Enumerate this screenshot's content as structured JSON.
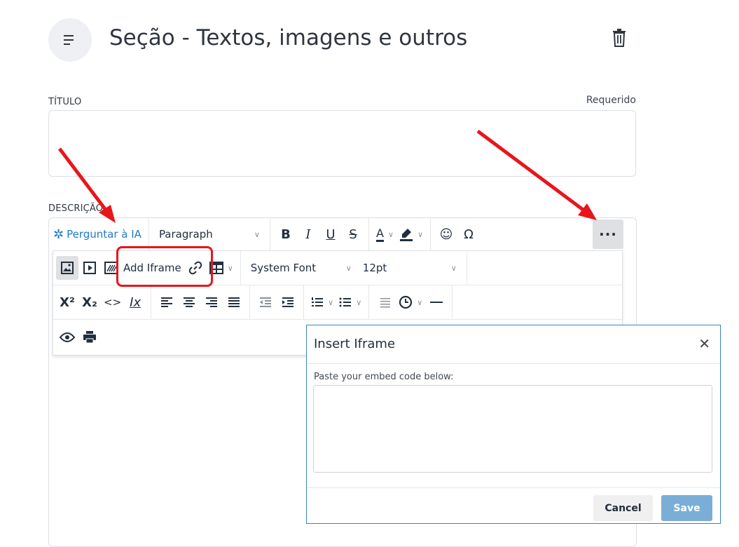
{
  "header": {
    "title": "Seção - Textos, imagens e outros"
  },
  "fields": {
    "title_label": "TÍTULO",
    "required_label": "Requerido",
    "description_label": "DESCRIÇÃO"
  },
  "toolbar": {
    "ai_button": "Perguntar à IA",
    "block_format": "Paragraph",
    "bold": "B",
    "italic": "I",
    "underline": "U",
    "strike": "S",
    "text_color": "A",
    "omega": "Ω",
    "more": "···",
    "add_iframe": "Add Iframe",
    "font_family": "System Font",
    "font_size": "12pt",
    "superscript": "X²",
    "subscript": "X₂",
    "code": "<>",
    "clear_format": "Ix"
  },
  "dialog": {
    "title": "Insert Iframe",
    "prompt": "Paste your embed code below:",
    "cancel": "Cancel",
    "save": "Save"
  },
  "colors": {
    "accent": "#1f7ac6",
    "annotation_red": "#e8161b",
    "save_button": "#7aaed6"
  },
  "icons": [
    "menu-icon",
    "trash-icon",
    "ai-asterisk-icon",
    "image-icon",
    "media-icon",
    "iframe-icon",
    "link-icon",
    "table-icon",
    "emoticon-icon",
    "preview-icon",
    "print-icon",
    "close-icon"
  ]
}
